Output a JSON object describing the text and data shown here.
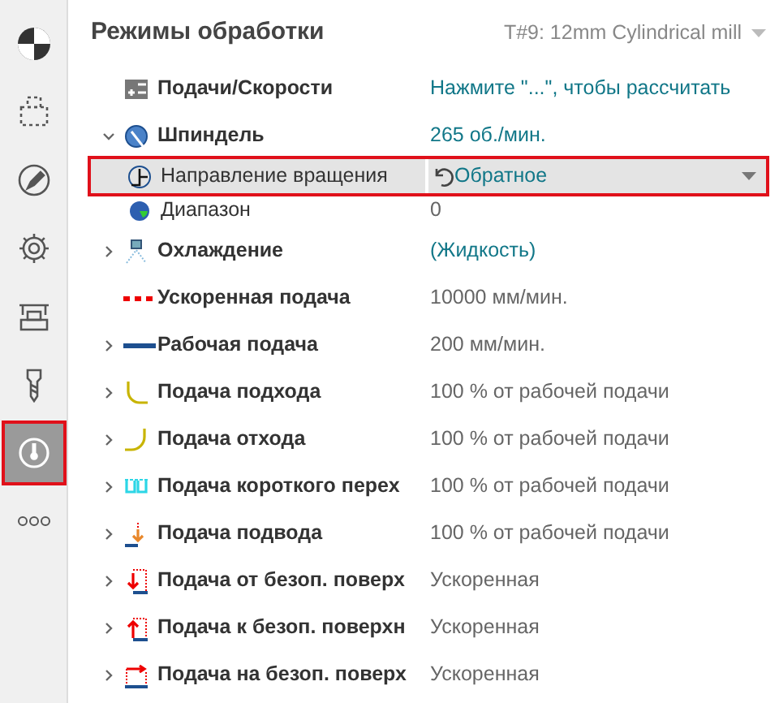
{
  "sidebar": {
    "items": [
      {
        "selected": false
      },
      {
        "selected": false
      },
      {
        "selected": false
      },
      {
        "selected": false
      },
      {
        "selected": false
      },
      {
        "selected": false
      },
      {
        "selected": true
      },
      {
        "selected": false
      }
    ]
  },
  "header": {
    "title": "Режимы обработки",
    "tool": "T#9: 12mm Cylindrical mill"
  },
  "rows": [
    {
      "label": "Подачи/Скорости",
      "value": "Нажмите \"...\", чтобы рассчитать",
      "link": true,
      "expandable": false,
      "selected": false
    },
    {
      "label": "Шпиндель",
      "value": "265 об./мин.",
      "link": true,
      "expandable": true,
      "expanded": true,
      "selected": false,
      "children": [
        {
          "label": "Направление вращения",
          "value": "Обратное",
          "link": true,
          "kind": "dropdown",
          "selected": true
        },
        {
          "label": "Диапазон",
          "value": "0",
          "link": false,
          "kind": "text",
          "selected": false
        }
      ]
    },
    {
      "label": "Охлаждение",
      "value": "(Жидкость)",
      "link": true,
      "expandable": true,
      "expanded": false,
      "selected": false
    },
    {
      "label": "Ускоренная подача",
      "value": "10000 мм/мин.",
      "link": false,
      "expandable": false,
      "selected": false
    },
    {
      "label": "Рабочая подача",
      "value": "200 мм/мин.",
      "link": false,
      "expandable": true,
      "expanded": false,
      "selected": false
    },
    {
      "label": "Подача подхода",
      "value": "100 % от рабочей подачи",
      "link": false,
      "expandable": true,
      "expanded": false,
      "selected": false
    },
    {
      "label": "Подача отхода",
      "value": "100 % от рабочей подачи",
      "link": false,
      "expandable": true,
      "expanded": false,
      "selected": false
    },
    {
      "label": "Подача короткого перех",
      "value": "100 % от рабочей подачи",
      "link": false,
      "expandable": true,
      "expanded": false,
      "selected": false
    },
    {
      "label": "Подача подвода",
      "value": "100 % от рабочей подачи",
      "link": false,
      "expandable": true,
      "expanded": false,
      "selected": false
    },
    {
      "label": "Подача от безоп. поверх",
      "value": "Ускоренная",
      "link": false,
      "expandable": true,
      "expanded": false,
      "selected": false
    },
    {
      "label": "Подача к безоп. поверхн",
      "value": "Ускоренная",
      "link": false,
      "expandable": true,
      "expanded": false,
      "selected": false
    },
    {
      "label": "Подача на безоп. поверх",
      "value": "Ускоренная",
      "link": false,
      "expandable": true,
      "expanded": false,
      "selected": false
    }
  ]
}
